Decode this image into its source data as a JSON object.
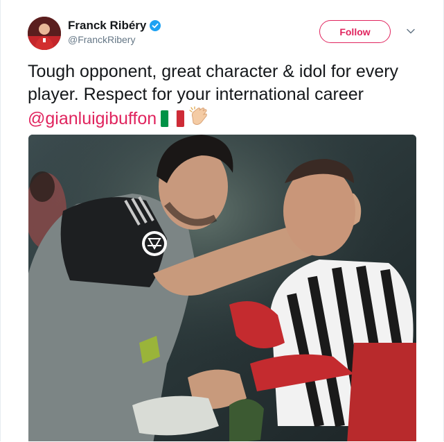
{
  "tweet": {
    "author": {
      "display_name": "Franck Ribéry",
      "handle": "@FranckRibery",
      "verified": true
    },
    "follow_label": "Follow",
    "text_before_mention": "Tough opponent, great character & idol for every player. Respect for your international career ",
    "mention": "@gianluigibuffon",
    "emojis": [
      "italy-flag-icon",
      "clapping-hands-icon"
    ],
    "media": {
      "type": "photo"
    }
  },
  "colors": {
    "accent": "#e0245e",
    "verified": "#1da1f2",
    "secondary_text": "#657786",
    "primary_text": "#14171a"
  }
}
